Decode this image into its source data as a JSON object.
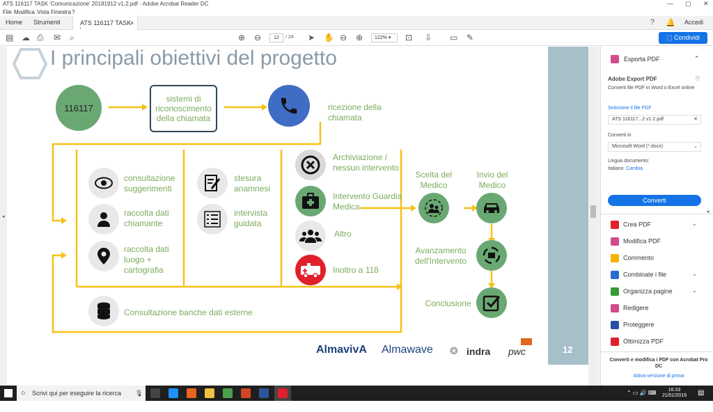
{
  "window": {
    "title": "ATS 116117 TASK 'Comunicazione' 20181912 v1.2.pdf - Adobe Acrobat Reader DC",
    "controls": [
      "—",
      "▢",
      "✕"
    ]
  },
  "menu": [
    "File",
    "Modifica",
    "Vista",
    "Finestra",
    "?"
  ],
  "tabs": {
    "home": "Home",
    "tools": "Strumenti",
    "document": "ATS 116117 TASK '...",
    "close": "×",
    "signin": "Accedi"
  },
  "toolbar": {
    "page_current": "12",
    "page_total": "/ 24",
    "zoom": "122%",
    "share": "Condividi"
  },
  "slide": {
    "title": "I principali obiettivi del progetto",
    "page_number": "12",
    "number_node": "116117",
    "recognition": "sistemi di riconoscimento della chiamata",
    "reception": "ricezione della chiamata",
    "consult": "consultazione suggerimenti",
    "collect_caller": "raccolta dati chiamante",
    "collect_place": "raccolta dati luogo + cartografia",
    "draft": "stesura anamnesi",
    "interview": "intervista guidata",
    "archive": "Archiviazione / nessun intervento",
    "guardia": "Intervento Guardia Medica",
    "other": "Altro",
    "forward118": "Inoltro a 118",
    "external_db": "Consultazione banche dati esterne",
    "choose_doctor": "Scelta del Medico",
    "send_doctor": "Invio del Medico",
    "progress": "Avanzamento dell'Intervento",
    "conclusion": "Conclusione",
    "logos": [
      "AlmavivA",
      "Almawave",
      "indra",
      "pwc"
    ],
    "colors": {
      "green": "#6aa873",
      "blue": "#3f6cc4",
      "yellow": "#f5c218",
      "red": "#e0202a",
      "title": "#8a9aa8"
    }
  },
  "panel": {
    "export_header": "Esporta PDF",
    "export_title": "Adobe Export PDF",
    "export_desc": "Converti file PDF in Word o Excel online",
    "select_file": "Selezione il file PDF",
    "file_name": "ATS 116117...2 v1.2.pdf",
    "convert_to": "Converti in",
    "format": "Microsoft Word (*.docx)",
    "lang_label": "Lingua documento:",
    "lang_value": "Italiano",
    "lang_change": "Cambia",
    "convert_button": "Converti",
    "tools": [
      {
        "label": "Crea PDF",
        "color": "#e0202a",
        "chevron": true
      },
      {
        "label": "Modifica PDF",
        "color": "#d04c8b",
        "chevron": false
      },
      {
        "label": "Commento",
        "color": "#f5b400",
        "chevron": false
      },
      {
        "label": "Combinate i file",
        "color": "#2b6cd1",
        "chevron": true
      },
      {
        "label": "Organizza pagine",
        "color": "#3a9a3a",
        "chevron": true
      },
      {
        "label": "Redigere",
        "color": "#d04c8b",
        "chevron": false
      },
      {
        "label": "Proteggere",
        "color": "#2b4fa8",
        "chevron": false
      },
      {
        "label": "Ottimizza PDF",
        "color": "#e0202a",
        "chevron": false
      }
    ],
    "footer_title": "Converti e modifica i PDF con Acrobat Pro DC",
    "footer_link": "Attiva versione di prova"
  },
  "taskbar": {
    "search": "Scrivi qui per eseguire la ricerca",
    "time": "16:33",
    "date": "21/01/2019"
  }
}
